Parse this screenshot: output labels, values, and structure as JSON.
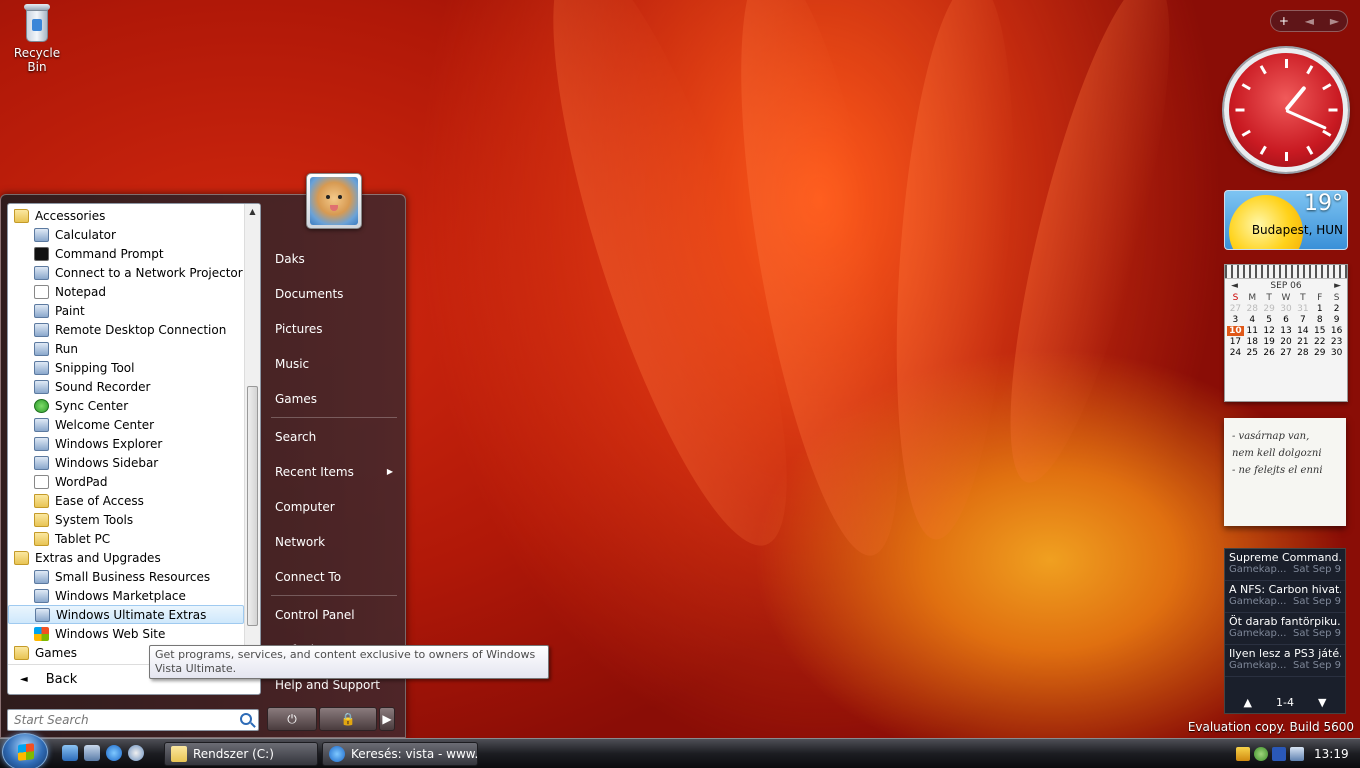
{
  "desktop": {
    "recycle_bin_label": "Recycle Bin",
    "watermark": "Evaluation copy. Build 5600"
  },
  "sidebar": {
    "toolbar": {
      "add": "+",
      "prev": "◄",
      "next": "►"
    },
    "clock": {
      "time": "13:19"
    },
    "weather": {
      "temperature": "19°",
      "location": "Budapest, HUN"
    },
    "calendar": {
      "month": "SEP 06",
      "prev": "◄",
      "next": "►",
      "day_headers": [
        "S",
        "M",
        "T",
        "W",
        "T",
        "F",
        "S"
      ],
      "rows": [
        [
          "27",
          "28",
          "29",
          "30",
          "31",
          "1",
          "2"
        ],
        [
          "3",
          "4",
          "5",
          "6",
          "7",
          "8",
          "9"
        ],
        [
          "10",
          "11",
          "12",
          "13",
          "14",
          "15",
          "16"
        ],
        [
          "17",
          "18",
          "19",
          "20",
          "21",
          "22",
          "23"
        ],
        [
          "24",
          "25",
          "26",
          "27",
          "28",
          "29",
          "30"
        ]
      ],
      "today": "10"
    },
    "notes": {
      "lines": [
        "- vasárnap van,",
        "nem kell dolgozni",
        "- ne felejts el enni"
      ]
    },
    "feeds": {
      "items": [
        {
          "title": "Supreme Command...",
          "source": "Gamekap...",
          "date": "Sat Sep 9"
        },
        {
          "title": "A NFS: Carbon hivat...",
          "source": "Gamekap...",
          "date": "Sat Sep 9"
        },
        {
          "title": "Öt darab fantörpiku...",
          "source": "Gamekap...",
          "date": "Sat Sep 9"
        },
        {
          "title": "Ilyen lesz a PS3 játé...",
          "source": "Gamekap...",
          "date": "Sat Sep 9"
        }
      ],
      "page": "1-4",
      "up": "▲",
      "down": "▼"
    }
  },
  "start_menu": {
    "programs": [
      {
        "label": "Accessories",
        "level": 0,
        "icon": "folder"
      },
      {
        "label": "Calculator",
        "level": 1,
        "icon": "app"
      },
      {
        "label": "Command Prompt",
        "level": 1,
        "icon": "cmd"
      },
      {
        "label": "Connect to a Network Projector",
        "level": 1,
        "icon": "app"
      },
      {
        "label": "Notepad",
        "level": 1,
        "icon": "doc"
      },
      {
        "label": "Paint",
        "level": 1,
        "icon": "app"
      },
      {
        "label": "Remote Desktop Connection",
        "level": 1,
        "icon": "app"
      },
      {
        "label": "Run",
        "level": 1,
        "icon": "app"
      },
      {
        "label": "Snipping Tool",
        "level": 1,
        "icon": "app"
      },
      {
        "label": "Sound Recorder",
        "level": 1,
        "icon": "app"
      },
      {
        "label": "Sync Center",
        "level": 1,
        "icon": "green"
      },
      {
        "label": "Welcome Center",
        "level": 1,
        "icon": "app"
      },
      {
        "label": "Windows Explorer",
        "level": 1,
        "icon": "app"
      },
      {
        "label": "Windows Sidebar",
        "level": 1,
        "icon": "app"
      },
      {
        "label": "WordPad",
        "level": 1,
        "icon": "doc"
      },
      {
        "label": "Ease of Access",
        "level": 1,
        "icon": "folder"
      },
      {
        "label": "System Tools",
        "level": 1,
        "icon": "folder"
      },
      {
        "label": "Tablet PC",
        "level": 1,
        "icon": "folder"
      },
      {
        "label": "Extras and Upgrades",
        "level": 0,
        "icon": "folder"
      },
      {
        "label": "Small Business Resources",
        "level": 1,
        "icon": "app"
      },
      {
        "label": "Windows Marketplace",
        "level": 1,
        "icon": "app"
      },
      {
        "label": "Windows Ultimate Extras",
        "level": 1,
        "icon": "app",
        "highlighted": true
      },
      {
        "label": "Windows Web Site",
        "level": 1,
        "icon": "win"
      },
      {
        "label": "Games",
        "level": 0,
        "icon": "folder"
      }
    ],
    "back_label": "Back",
    "search_placeholder": "Start Search",
    "right_items": {
      "user": "Daks",
      "documents": "Documents",
      "pictures": "Pictures",
      "music": "Music",
      "games": "Games",
      "search": "Search",
      "recent_items": "Recent Items",
      "computer": "Computer",
      "network": "Network",
      "connect_to": "Connect To",
      "control_panel": "Control Panel",
      "default_programs": "Default Programs",
      "help_support": "Help and Support"
    },
    "tooltip": "Get programs, services, and content exclusive to owners of Windows Vista Ultimate."
  },
  "taskbar": {
    "tasks": [
      {
        "label": "Rendszer (C:)"
      },
      {
        "label": "Keresés: vista - www..."
      }
    ],
    "clock": "13:19"
  }
}
